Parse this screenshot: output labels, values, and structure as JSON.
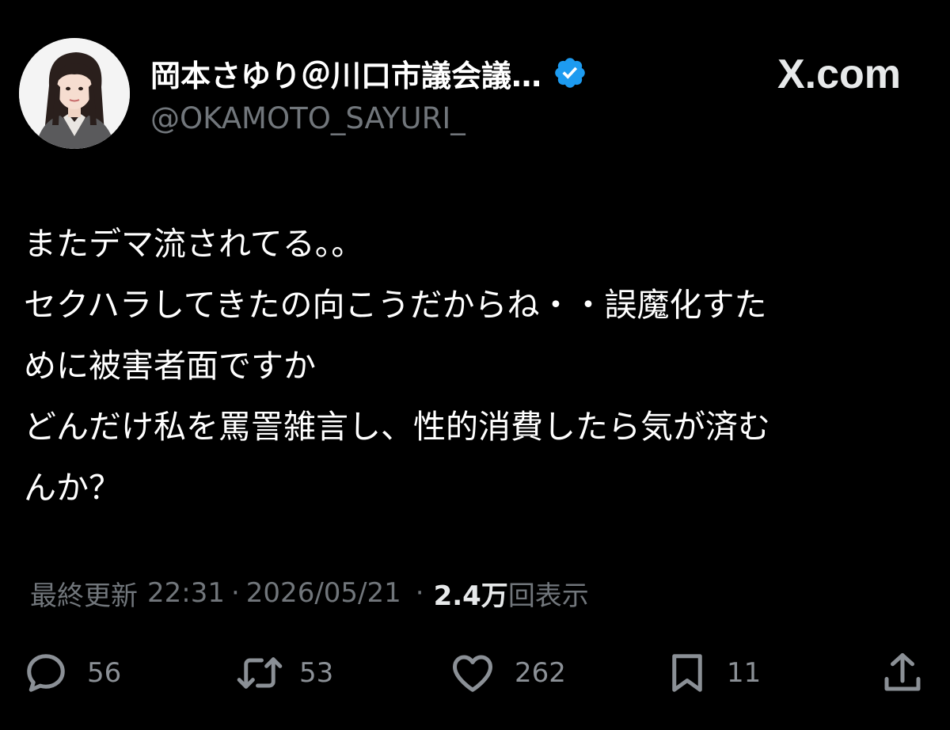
{
  "header": {
    "display_name": "岡本さゆり＠川口市議会議…",
    "handle": "@OKAMOTO_SAYURI_",
    "site_label": "X.com",
    "verified": true
  },
  "tweet": {
    "lines": [
      "またデマ流されてる。。",
      "セクハラしてきたの向こうだからね・・誤魔化すた",
      "めに被害者面ですか",
      "どんだけ私を罵詈雑言し、性的消費したら気が済む",
      "んか？"
    ]
  },
  "meta": {
    "prefix": "最終更新",
    "time": "22:31",
    "date": "2026/05/21",
    "views_count": "2.4万",
    "views_label": "回表示"
  },
  "actions": {
    "reply_count": "56",
    "repost_count": "53",
    "like_count": "262",
    "bookmark_count": "11"
  },
  "colors": {
    "background": "#000000",
    "text_primary": "#ffffff",
    "text_secondary": "#71767b",
    "verified_blue": "#1d9bf0"
  },
  "icons": {
    "reply": "speech-bubble-icon",
    "repost": "repost-arrows-icon",
    "like": "heart-icon",
    "bookmark": "bookmark-icon",
    "share": "share-upload-icon",
    "verified": "verified-badge-icon"
  }
}
